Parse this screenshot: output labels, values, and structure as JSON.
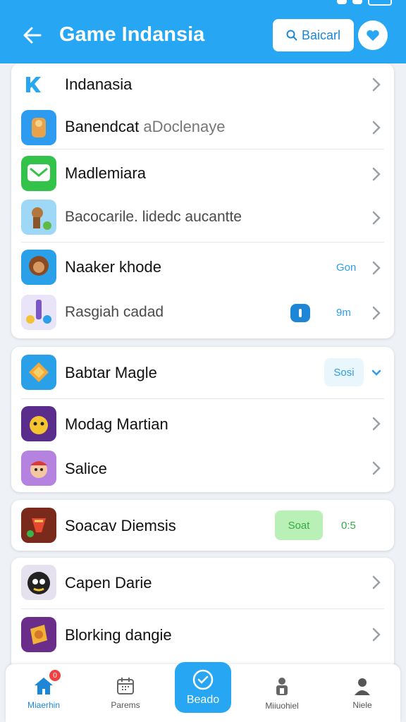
{
  "header": {
    "title": "Game Indansia",
    "search_label": "Baicarl"
  },
  "cards": [
    {
      "section_title": "Indanasia",
      "rows": [
        {
          "name": "Banendcat",
          "sub": "aDoclenaye"
        },
        {
          "name": "Madlemiara"
        },
        {
          "name": "Bacocarile. lidedc aucantte"
        },
        {
          "name": "Naaker khode",
          "tag": "Gon"
        },
        {
          "name": "Rasgiah cadad",
          "tag": "9m"
        }
      ]
    },
    {
      "rows": [
        {
          "name": "Babtar Magle",
          "tag": "Sosi"
        },
        {
          "name": "Modag Martian"
        },
        {
          "name": "Salice"
        }
      ]
    },
    {
      "rows": [
        {
          "name": "Soacav Diemsis",
          "pill": "Soat",
          "tag": "0:5"
        }
      ]
    },
    {
      "rows": [
        {
          "name": "Capen Darie"
        },
        {
          "name": "Blorking dangie"
        }
      ]
    }
  ],
  "tabbar": {
    "tabs": [
      {
        "label": "Miaerhin",
        "badge": "0"
      },
      {
        "label": "Parems"
      },
      {
        "label": "Beado"
      },
      {
        "label": "Miiuohiel"
      },
      {
        "label": "Niele"
      }
    ]
  },
  "colors": {
    "accent": "#27a7f3",
    "badge": "#f04040",
    "pill_green": "#b9f0b6"
  },
  "icons": {
    "back": "arrow-left-icon",
    "search": "search-icon",
    "favorite": "heart-icon",
    "section": "k-logo-icon",
    "chevron": "chevron-right-icon"
  }
}
